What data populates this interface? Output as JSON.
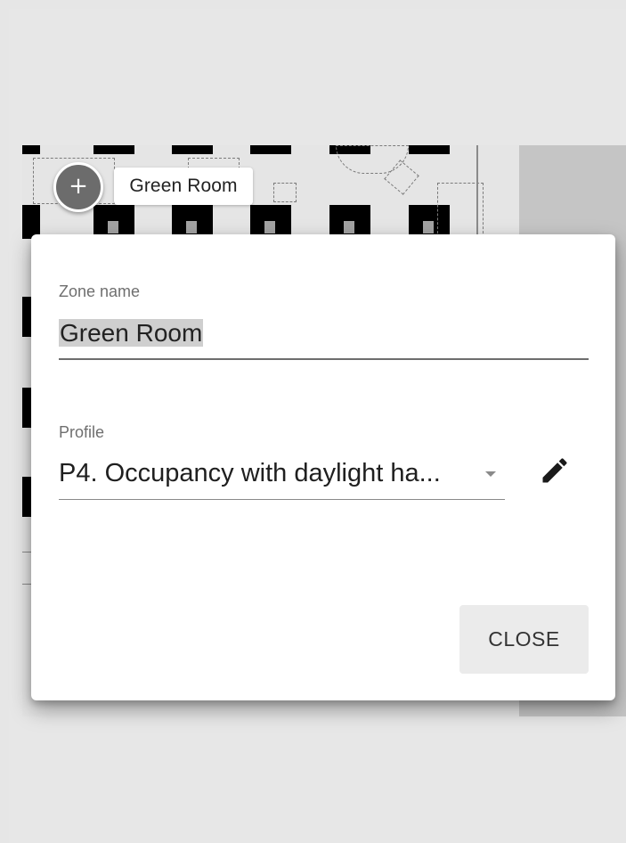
{
  "zone_marker": {
    "icon": "plus-icon",
    "label": "Green Room"
  },
  "dialog": {
    "zone_name": {
      "label": "Zone name",
      "value": "Green Room"
    },
    "profile": {
      "label": "Profile",
      "value": "P4. Occupancy with daylight ha...",
      "dropdown_icon": "chevron-down-icon"
    },
    "edit_icon": "pencil-icon",
    "close_label": "CLOSE"
  }
}
